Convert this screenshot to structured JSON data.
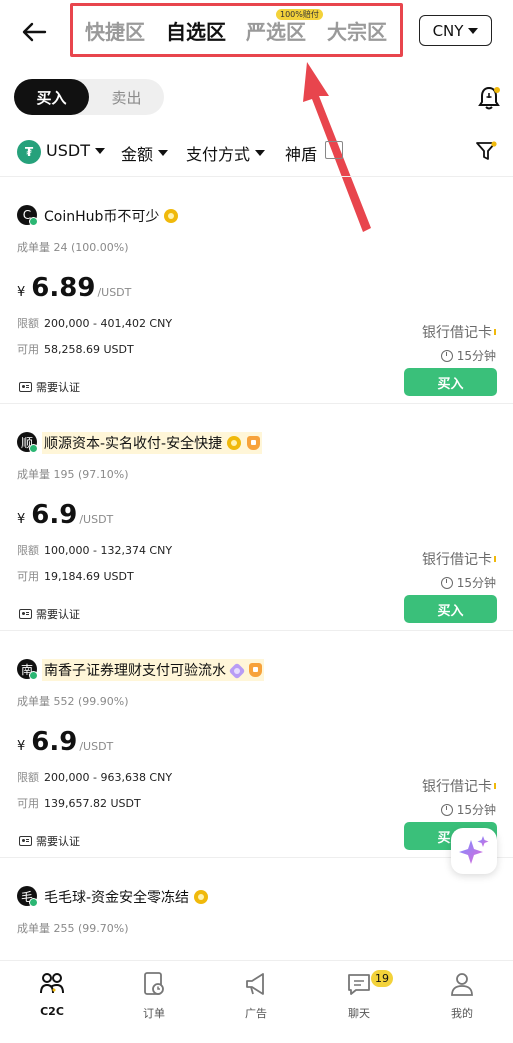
{
  "header": {
    "tabs": [
      {
        "label": "快捷区"
      },
      {
        "label": "自选区"
      },
      {
        "label": "严选区"
      },
      {
        "label": "大宗区"
      }
    ],
    "strict_badge": "100%赔付",
    "currency": "CNY"
  },
  "toggle": {
    "buy": "买入",
    "sell": "卖出"
  },
  "filters": {
    "coin_icon": "₮",
    "coin": "USDT",
    "amount": "金额",
    "payment": "支付方式",
    "shield": "神盾"
  },
  "listings": [
    {
      "avatar": "C",
      "merchant": "CoinHub币不可少",
      "orders_label": "成单量",
      "orders": "24 (100.00%)",
      "yen": "¥",
      "price": "6.89",
      "unit": "/USDT",
      "limit_label": "限额",
      "limit": "200,000 - 401,402 CNY",
      "avail_label": "可用",
      "avail": "58,258.69 USDT",
      "kyc": "需要认证",
      "payment": "银行借记卡",
      "time": "15分钟",
      "buy": "买入"
    },
    {
      "avatar": "顺",
      "merchant": "顺源资本-实名收付-安全快捷",
      "orders_label": "成单量",
      "orders": "195 (97.10%)",
      "yen": "¥",
      "price": "6.9",
      "unit": "/USDT",
      "limit_label": "限额",
      "limit": "100,000 - 132,374 CNY",
      "avail_label": "可用",
      "avail": "19,184.69 USDT",
      "kyc": "需要认证",
      "payment": "银行借记卡",
      "time": "15分钟",
      "buy": "买入"
    },
    {
      "avatar": "南",
      "merchant": "南香子证券理财支付可验流水",
      "orders_label": "成单量",
      "orders": "552 (99.90%)",
      "yen": "¥",
      "price": "6.9",
      "unit": "/USDT",
      "limit_label": "限额",
      "limit": "200,000 - 963,638 CNY",
      "avail_label": "可用",
      "avail": "139,657.82 USDT",
      "kyc": "需要认证",
      "payment": "银行借记卡",
      "time": "15分钟",
      "buy": "买入"
    },
    {
      "avatar": "毛",
      "merchant": "毛毛球-资金安全零冻结",
      "orders_label": "成单量",
      "orders": "255 (99.70%)"
    }
  ],
  "bottom_nav": [
    {
      "label": "C2C",
      "icon": "people-icon",
      "active": true
    },
    {
      "label": "订单",
      "icon": "order-icon"
    },
    {
      "label": "广告",
      "icon": "megaphone-icon"
    },
    {
      "label": "聊天",
      "icon": "chat-icon",
      "badge": "19"
    },
    {
      "label": "我的",
      "icon": "profile-icon"
    }
  ],
  "colors": {
    "accent_green": "#3ac07a",
    "highlight_red": "#e8454d",
    "badge_yellow": "#f3d23a"
  }
}
